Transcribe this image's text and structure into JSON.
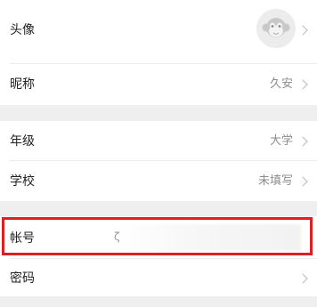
{
  "profile": {
    "avatar": {
      "label": "头像",
      "icon": "monkey-avatar-icon"
    },
    "nickname": {
      "label": "昵称",
      "value": "久安"
    }
  },
  "education": {
    "grade": {
      "label": "年级",
      "value": "大学"
    },
    "school": {
      "label": "学校",
      "value": "未填写"
    }
  },
  "security": {
    "account": {
      "label": "帐号",
      "value": ""
    },
    "password": {
      "label": "密码"
    }
  },
  "colors": {
    "background": "#efefef",
    "row": "#ffffff",
    "label": "#222222",
    "value": "#8c8c8c",
    "chevron": "#b8b8b8",
    "highlight": "#e02020"
  }
}
